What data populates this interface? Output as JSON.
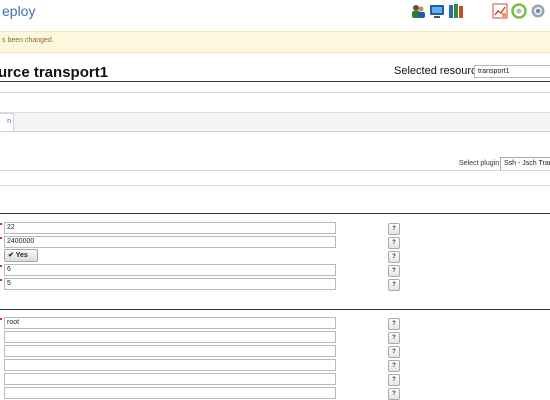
{
  "app": {
    "brand": "eploy"
  },
  "toolbar": {
    "icons": [
      "users-icon",
      "monitor-icon",
      "books-icon",
      "chart-icon",
      "refresh-icon",
      "settings-icon",
      "help-icon"
    ]
  },
  "notice": {
    "text": "s been changed."
  },
  "page": {
    "title": "urce transport1"
  },
  "selected_resource": {
    "label": "Selected resource:",
    "value": "transport1"
  },
  "tabs": [
    {
      "label": "n"
    }
  ],
  "plugin": {
    "label": "Select plugin",
    "value": "Ssh - Jsch Transport"
  },
  "section1": {
    "fields": [
      {
        "value": "22",
        "required": true
      },
      {
        "value": "2400000",
        "required": true
      },
      {
        "value": "6",
        "required": true
      },
      {
        "value": "5",
        "required": true
      }
    ],
    "toggle_label": "Yes"
  },
  "section2": {
    "fields": [
      {
        "value": "root",
        "required": true
      },
      {
        "value": "",
        "required": false
      },
      {
        "value": "",
        "required": false
      },
      {
        "value": "",
        "required": false
      },
      {
        "value": "",
        "required": false
      },
      {
        "value": "",
        "required": false
      }
    ]
  },
  "help_label": "?",
  "colors": {
    "accent": "#3d6fae",
    "notice_bg": "#fdf7de",
    "notice_text": "#8a6d2a",
    "required": "#c0392b"
  }
}
